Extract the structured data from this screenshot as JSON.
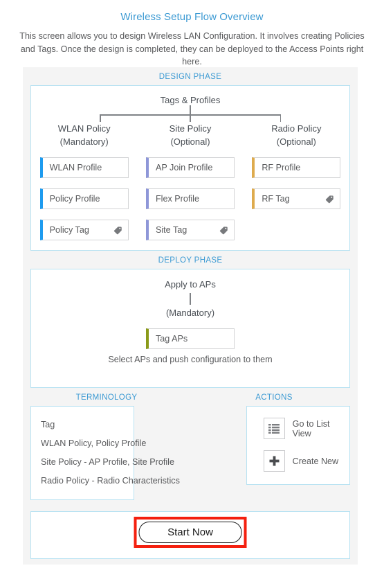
{
  "header": {
    "title": "Wireless Setup Flow Overview",
    "description": "This screen allows you to design Wireless LAN Configuration. It involves creating Policies and Tags. Once the design is completed, they can be deployed to the Access Points right here."
  },
  "design": {
    "section_label": "DESIGN PHASE",
    "tree_root": "Tags & Profiles",
    "columns": [
      {
        "title": "WLAN Policy",
        "subtitle": "(Mandatory)"
      },
      {
        "title": "Site Policy",
        "subtitle": "(Optional)"
      },
      {
        "title": "Radio Policy",
        "subtitle": "(Optional)"
      }
    ],
    "rows": [
      [
        {
          "label": "WLAN Profile",
          "accent": "blue",
          "accent_hex": "#1d9bef",
          "tag_icon": false
        },
        {
          "label": "AP Join Profile",
          "accent": "indigo",
          "accent_hex": "#8e97d8",
          "tag_icon": false
        },
        {
          "label": "RF Profile",
          "accent": "gold",
          "accent_hex": "#deab4e",
          "tag_icon": false
        }
      ],
      [
        {
          "label": "Policy Profile",
          "accent": "blue",
          "accent_hex": "#1d9bef",
          "tag_icon": false
        },
        {
          "label": "Flex Profile",
          "accent": "indigo",
          "accent_hex": "#8e97d8",
          "tag_icon": false
        },
        {
          "label": "RF Tag",
          "accent": "gold",
          "accent_hex": "#deab4e",
          "tag_icon": true
        }
      ],
      [
        {
          "label": "Policy Tag",
          "accent": "blue",
          "accent_hex": "#1d9bef",
          "tag_icon": true
        },
        {
          "label": "Site Tag",
          "accent": "indigo",
          "accent_hex": "#8e97d8",
          "tag_icon": true
        },
        {
          "label": "",
          "accent": "empty",
          "accent_hex": "",
          "tag_icon": false
        }
      ]
    ]
  },
  "deploy": {
    "section_label": "DEPLOY PHASE",
    "root": "Apply to APs",
    "subtitle": "(Mandatory)",
    "chip": {
      "label": "Tag APs",
      "accent": "olive",
      "accent_hex": "#8a9a19"
    },
    "note": "Select APs and push configuration to them"
  },
  "terminology": {
    "section_label": "TERMINOLOGY",
    "items": [
      "Tag",
      "WLAN Policy, Policy Profile",
      "Site Policy - AP Profile, Site Profile",
      "Radio Policy - Radio Characteristics"
    ]
  },
  "actions": {
    "section_label": "ACTIONS",
    "items": [
      {
        "label": "Go to List View",
        "icon": "list-view-icon"
      },
      {
        "label": "Create New",
        "icon": "plus-icon"
      }
    ]
  },
  "footer": {
    "start_button": "Start Now",
    "highlight_color": "#f4200f"
  },
  "theme": {
    "accent_blue": "#3c9ad3",
    "panel_border": "#b8e2f2",
    "shell_bg": "#f4f4f4",
    "text": "#58595b"
  }
}
